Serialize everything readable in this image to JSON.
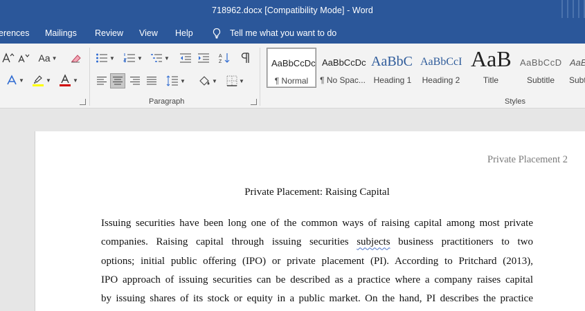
{
  "window": {
    "title": "718962.docx [Compatibility Mode]  -  Word"
  },
  "menu": {
    "tabs": [
      "erences",
      "Mailings",
      "Review",
      "View",
      "Help"
    ],
    "tell_me": "Tell me what you want to do"
  },
  "ribbon": {
    "paragraph_label": "Paragraph",
    "styles_label": "Styles",
    "font_size_sample": "Aa",
    "styles": [
      {
        "sample": "AaBbCcDc",
        "name": "¶ Normal",
        "active": true
      },
      {
        "sample": "AaBbCcDc",
        "name": "¶ No Spac..."
      },
      {
        "sample": "AaBbC",
        "name": "Heading 1"
      },
      {
        "sample": "AaBbCcI",
        "name": "Heading 2"
      },
      {
        "sample": "AaB",
        "name": "Title"
      },
      {
        "sample": "AaBbCcD",
        "name": "Subtitle"
      },
      {
        "sample": "AaBl",
        "name": "Subtl"
      }
    ],
    "colors": {
      "highlight": "#ffff00",
      "font_color": "#d00000",
      "accent": "#2b579a"
    }
  },
  "document": {
    "header": "Private Placement 2",
    "title": "Private Placement: Raising Capital",
    "lines": [
      {
        "text": "Issuing securities have been long one of the common ways of raising capital among most private"
      },
      {
        "pre": "companies. Raising capital through issuing securities ",
        "flagged": "subjects",
        "post": " business practitioners to two"
      },
      {
        "text": "options; initial public offering (IPO) or private placement (PI). According to Pritchard (2013),"
      },
      {
        "text": "IPO approach of issuing securities can be described as a practice where a company raises capital"
      },
      {
        "text": "by issuing shares of its stock or equity in a public market. On the hand, PI describes the practice"
      }
    ]
  }
}
